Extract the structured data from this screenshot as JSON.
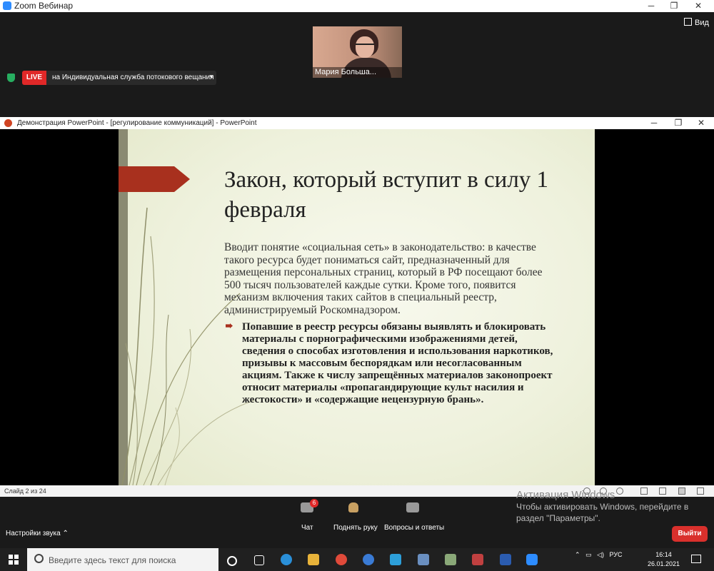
{
  "zoom": {
    "window_title": "Zoom Вебинар",
    "participant_name": "Мария Больша...",
    "view_label": "Вид",
    "live_badge": "LIVE",
    "live_text": "на Индивидуальная служба потокового вещания",
    "toolbar": {
      "audio_settings": "Настройки звука",
      "chat_label": "Чат",
      "chat_badge": "6",
      "raise_hand_label": "Поднять руку",
      "qa_label": "Вопросы и ответы",
      "leave_label": "Выйти"
    }
  },
  "ppt": {
    "window_title": "Демонстрация PowerPoint - [регулирование коммуникаций] - PowerPoint",
    "slide_counter": "Слайд 2 из 24"
  },
  "slide": {
    "title": "Закон, который вступит в силу 1 февраля",
    "paragraph": "Вводит понятие «социальная сеть» в законодательство: в качестве такого ресурса будет пониматься сайт, предназначенный для размещения персональных страниц, который в РФ посещают более 500 тысяч пользователей каждые сутки. Кроме того, появится механизм включения таких сайтов в специальный реестр, администрируемый Роскомнадзором.",
    "bullet": "Попавшие в реестр ресурсы обязаны выявлять и блокировать материалы с порнографическими изображениями детей, сведения о способах изготовления и использования наркотиков, призывы к массовым беспорядкам или несогласованным акциям. Также к числу запрещённых материалов законопроект относит материалы «пропагандирующие культ насилия и жестокости» и «содержащие нецензурную брань»."
  },
  "windows": {
    "activation_title": "Активация Windows",
    "activation_text_1": "Чтобы активировать Windows, перейдите в",
    "activation_text_2": "раздел \"Параметры\".",
    "search_placeholder": "Введите здесь текст для поиска",
    "language": "РУС",
    "time": "16:14",
    "date": "26.01.2021"
  }
}
